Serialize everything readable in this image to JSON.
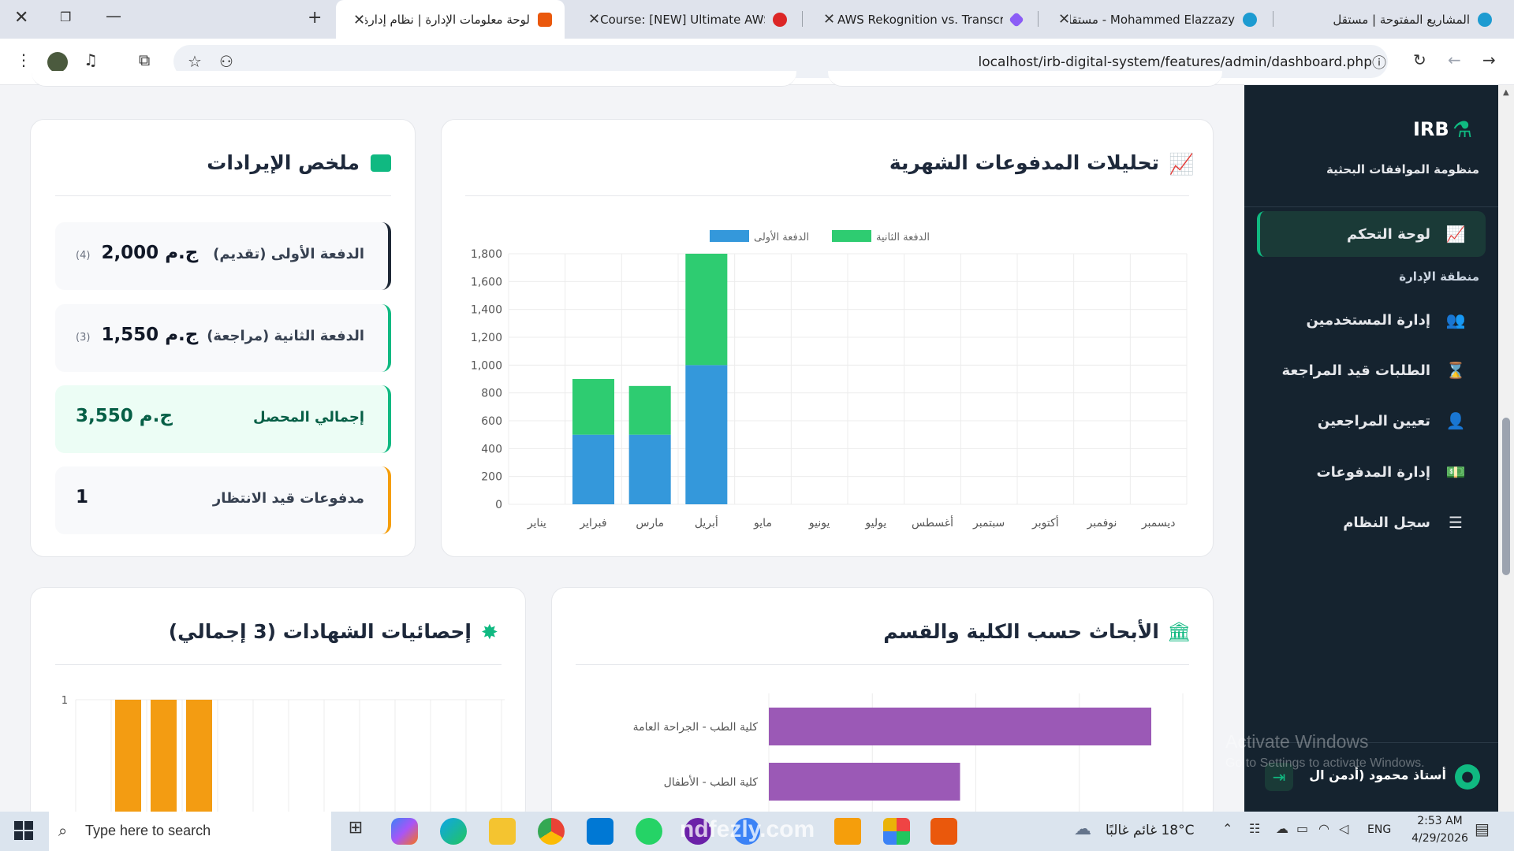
{
  "browser": {
    "tabs": [
      {
        "title": "المشاريع المفتوحة | مستقل",
        "color": "#1d9bd1"
      },
      {
        "title": "Mohammed Elazzazy - مستقل |",
        "color": "#1d9bd1"
      },
      {
        "title": "AWS Rekognition vs. Transcribe",
        "color": "#8b5cf6"
      },
      {
        "title": "Course: [NEW] Ultimate AWS C",
        "color": "#dc2626"
      },
      {
        "title": "لوحة معلومات الإدارة | نظام إدارة",
        "color": "#ea580c"
      }
    ],
    "url": "localhost/irb-digital-system/features/admin/dashboard.php"
  },
  "sidebar": {
    "brand": "IRB",
    "subtitle": "منظومة الموافقات البحثية",
    "active_item": "لوحة التحكم",
    "section": "منطقة الإدارة",
    "items": [
      {
        "label": "إدارة المستخدمين",
        "icon": "users-icon"
      },
      {
        "label": "الطلبات قيد المراجعة",
        "icon": "hourglass-icon"
      },
      {
        "label": "تعيين المراجعين",
        "icon": "user-check-icon"
      },
      {
        "label": "إدارة المدفوعات",
        "icon": "money-icon"
      },
      {
        "label": "سجل النظام",
        "icon": "list-icon"
      }
    ],
    "user": "أستاذ محمود (أدمن ال"
  },
  "watermark": {
    "line1": "Activate Windows",
    "line2": "Go to Settings to activate Windows."
  },
  "revenue": {
    "title": "ملخص الإيرادات",
    "rows": [
      {
        "label": "الدفعة الأولى (تقديم)",
        "value": "2,000 ج.م",
        "count": "(4)",
        "accent": "#1f2937"
      },
      {
        "label": "الدفعة الثانية (مراجعة)",
        "value": "1,550 ج.م",
        "count": "(3)",
        "accent": "#10b981"
      },
      {
        "label": "إجمالي المحصل",
        "value": "3,550 ج.م",
        "count": "",
        "accent": "#10b981"
      },
      {
        "label": "مدفوعات قيد الانتظار",
        "value": "1",
        "count": "",
        "accent": "#f59e0b"
      }
    ]
  },
  "payments_chart_title": "تحليلات المدفوعات الشهرية",
  "faculty_title": "الأبحاث حسب الكلية والقسم",
  "degrees_title": "إحصائيات الشهادات (3 إجمالي)",
  "chart_data": [
    {
      "type": "bar",
      "stacked": true,
      "categories": [
        "يناير",
        "فبراير",
        "مارس",
        "أبريل",
        "مايو",
        "يونيو",
        "يوليو",
        "أغسطس",
        "سبتمبر",
        "أكتوبر",
        "نوفمبر",
        "ديسمبر"
      ],
      "series": [
        {
          "name": "الدفعة الأولى",
          "color": "#3498db",
          "values": [
            0,
            500,
            500,
            1000,
            0,
            0,
            0,
            0,
            0,
            0,
            0,
            0
          ]
        },
        {
          "name": "الدفعة الثانية",
          "color": "#2ecc71",
          "values": [
            0,
            400,
            350,
            800,
            0,
            0,
            0,
            0,
            0,
            0,
            0,
            0
          ]
        }
      ],
      "ylim": [
        0,
        1800
      ],
      "yticks": [
        "0",
        "200",
        "400",
        "600",
        "800",
        "1,000",
        "1,200",
        "1,400",
        "1,600",
        "1,800"
      ],
      "legend": "top"
    },
    {
      "type": "bar",
      "orientation": "horizontal",
      "categories": [
        "كلية الطب - الجراحة العامة",
        "كلية الطب - الأطفال"
      ],
      "values": [
        2,
        1
      ],
      "color": "#9b59b6"
    },
    {
      "type": "bar",
      "values": [
        1,
        1,
        1
      ],
      "color": "#f39c12",
      "yticks": [
        "1"
      ]
    }
  ],
  "taskbar": {
    "search": "Type here to search",
    "weather": "18°C  غائم غالبًا",
    "lang": "ENG",
    "time": "2:53 AM",
    "date": "4/29/2026",
    "logo": "ndfezly.com"
  }
}
